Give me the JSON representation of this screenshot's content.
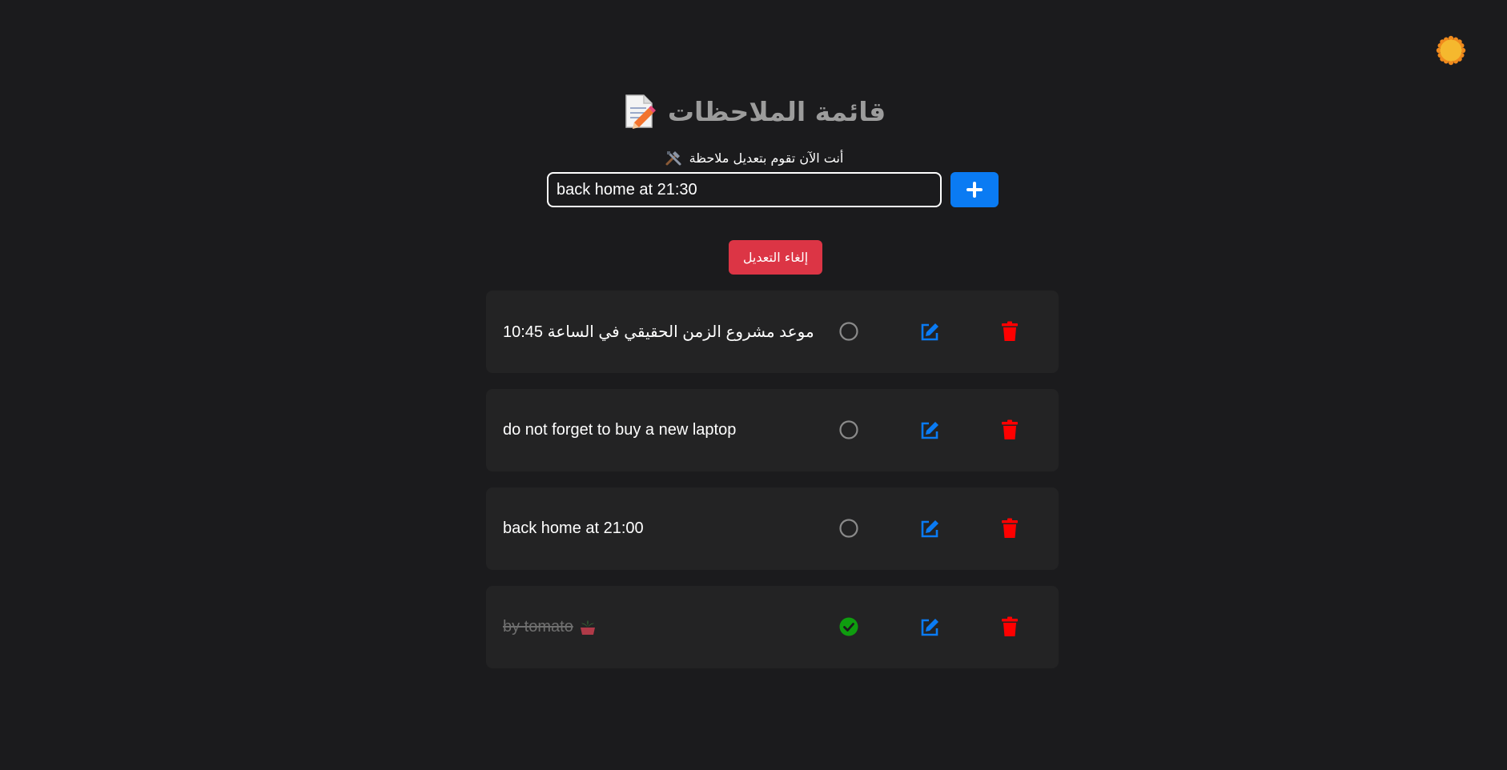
{
  "theme_toggle": {
    "icon": "sun-icon",
    "color": "#f5b82e"
  },
  "header": {
    "title": "قائمة الملاحظات",
    "title_icon": "memo-icon"
  },
  "editor": {
    "status_text": "أنت الآن تقوم بتعديل ملاحظة",
    "status_icon": "tools-icon",
    "input_value": "back home at 21:30",
    "add_button_icon": "plus-icon",
    "cancel_label": "إلغاء التعديل"
  },
  "notes": [
    {
      "text": "موعد مشروع الزمن الحقيقي في الساعة 10:45",
      "completed": false,
      "direction": "rtl"
    },
    {
      "text": "do not forget to buy a new laptop",
      "completed": false,
      "direction": "ltr"
    },
    {
      "text": "back home at 21:00",
      "completed": false,
      "direction": "ltr"
    },
    {
      "text": "by tomato",
      "completed": true,
      "direction": "ltr",
      "emoji": "tomato-plant-icon"
    }
  ],
  "colors": {
    "background": "#1b1b1d",
    "card": "#232324",
    "primary": "#0a7bf3",
    "danger": "#dc3545",
    "delete_icon": "#ff0000",
    "done": "#0f9d0f"
  }
}
